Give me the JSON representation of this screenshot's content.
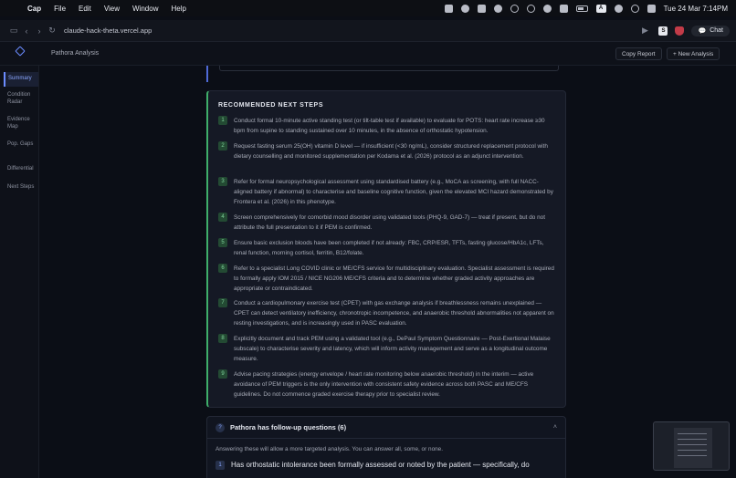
{
  "menubar": {
    "app": "Cap",
    "items": [
      "File",
      "Edit",
      "View",
      "Window",
      "Help"
    ],
    "clock": "Tue 24 Mar  7:14PM",
    "kbd_label": "A"
  },
  "browser": {
    "url": "claude-hack-theta.vercel.app",
    "chat_label": "Chat",
    "ext_label": "S"
  },
  "header": {
    "title": "Pathora Analysis",
    "copy_report": "Copy Report",
    "new_analysis": "+ New Analysis"
  },
  "sidebar": {
    "items": [
      "Summary",
      "Condition Radar",
      "Evidence Map",
      "Pop. Gaps",
      "Differential",
      "Next Steps"
    ]
  },
  "next_steps": {
    "title": "RECOMMENDED NEXT STEPS",
    "items": [
      {
        "num": "1",
        "text": "Conduct formal 10-minute active standing test (or tilt-table test if available) to evaluate for POTS: heart rate increase ≥30 bpm from supine to standing sustained over 10 minutes, in the absence of orthostatic hypotension."
      },
      {
        "num": "2",
        "text": "Request fasting serum 25(OH) vitamin D level — if insufficient (<30 ng/mL), consider structured replacement protocol with dietary counselling and monitored supplementation per Kodama et al. (2026) protocol as an adjunct intervention."
      },
      {
        "num": "3",
        "text": "Refer for formal neuropsychological assessment using standardised battery (e.g., MoCA as screening, with full NACC-aligned battery if abnormal) to characterise and baseline cognitive function, given the elevated MCI hazard demonstrated by Frontera et al. (2026) in this phenotype."
      },
      {
        "num": "4",
        "text": "Screen comprehensively for comorbid mood disorder using validated tools (PHQ-9, GAD-7) — treat if present, but do not attribute the full presentation to it if PEM is confirmed."
      },
      {
        "num": "5",
        "text": "Ensure basic exclusion bloods have been completed if not already: FBC, CRP/ESR, TFTs, fasting glucose/HbA1c, LFTs, renal function, morning cortisol, ferritin, B12/folate."
      },
      {
        "num": "6",
        "text": "Refer to a specialist Long COVID clinic or ME/CFS service for multidisciplinary evaluation. Specialist assessment is required to formally apply IOM 2015 / NICE NG206 ME/CFS criteria and to determine whether graded activity approaches are appropriate or contraindicated."
      },
      {
        "num": "7",
        "text": "Conduct a cardiopulmonary exercise test (CPET) with gas exchange analysis if breathlessness remains unexplained — CPET can detect ventilatory inefficiency, chronotropic incompetence, and anaerobic threshold abnormalities not apparent on resting investigations, and is increasingly used in PASC evaluation."
      },
      {
        "num": "8",
        "text": "Explicitly document and track PEM using a validated tool (e.g., DePaul Symptom Questionnaire — Post-Exertional Malaise subscale) to characterise severity and latency, which will inform activity management and serve as a longitudinal outcome measure."
      },
      {
        "num": "9",
        "text": "Advise pacing strategies (energy envelope / heart rate monitoring below anaerobic threshold) in the interim — active avoidance of PEM triggers is the only intervention with consistent safety evidence across both PASC and ME/CFS guidelines. Do not commence graded exercise therapy prior to specialist review."
      }
    ]
  },
  "followup": {
    "icon_text": "?",
    "title": "Pathora has follow-up questions (6)",
    "desc": "Answering these will allow a more targeted analysis. You can answer all, some, or none.",
    "first_q_num": "1",
    "first_q_text": "Has orthostatic intolerance been formally assessed or noted by the patient — specifically, do"
  }
}
